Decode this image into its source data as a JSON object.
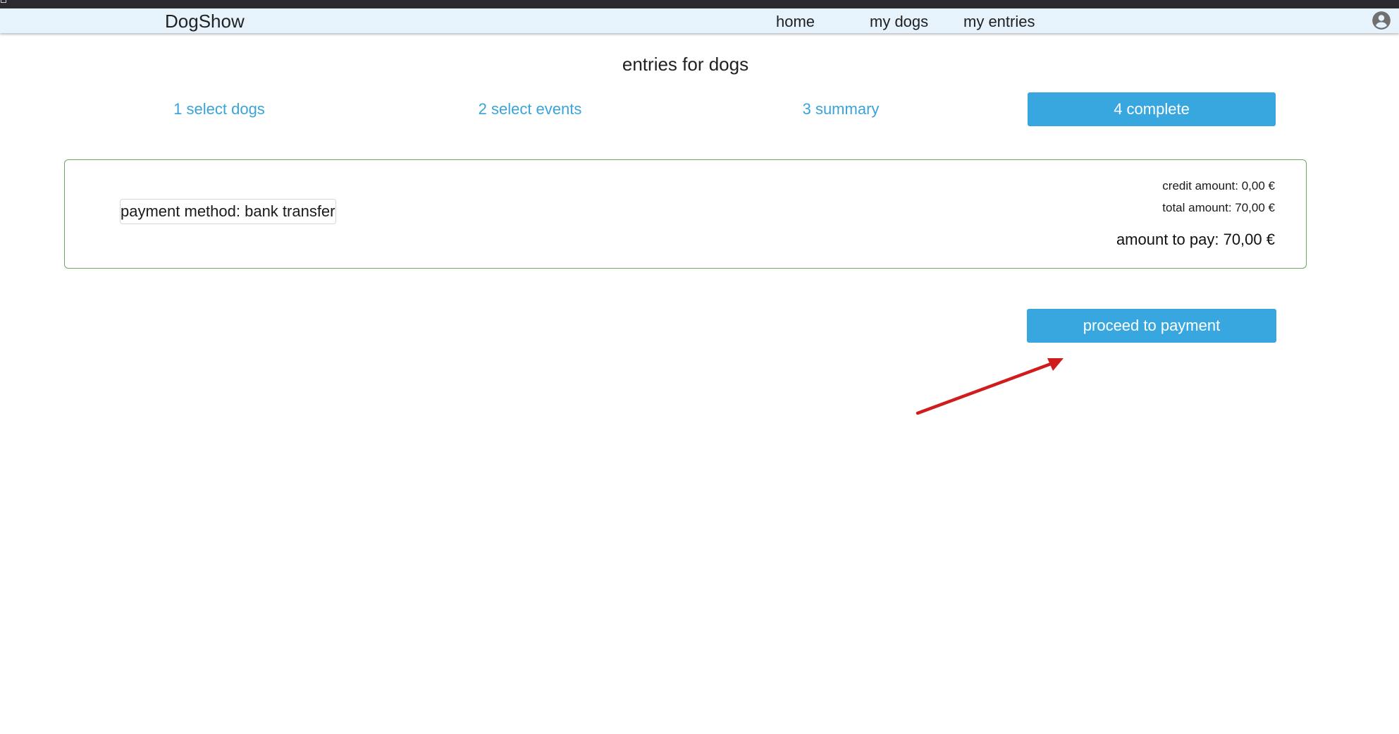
{
  "navbar": {
    "brand": "DogShow",
    "links": {
      "home": "home",
      "my_dogs": "my dogs",
      "my_entries": "my entries"
    },
    "account_icon": "account-circle-icon"
  },
  "page": {
    "title": "entries for dogs"
  },
  "steps": [
    {
      "label": "1 select dogs",
      "active": false
    },
    {
      "label": "2 select events",
      "active": false
    },
    {
      "label": "3 summary",
      "active": false
    },
    {
      "label": "4 complete",
      "active": true
    }
  ],
  "summary": {
    "payment_method": "payment method: bank transfer",
    "credit_amount": "credit amount: 0,00 €",
    "total_amount": "total amount: 70,00 €",
    "amount_to_pay": "amount to pay: 70,00 €"
  },
  "actions": {
    "proceed_label": "proceed to payment"
  },
  "colors": {
    "accent": "#38a7e0",
    "navbar_bg": "#e6f3fc",
    "card_border": "#6aaa5e",
    "annotation_arrow": "#d01c1c"
  }
}
